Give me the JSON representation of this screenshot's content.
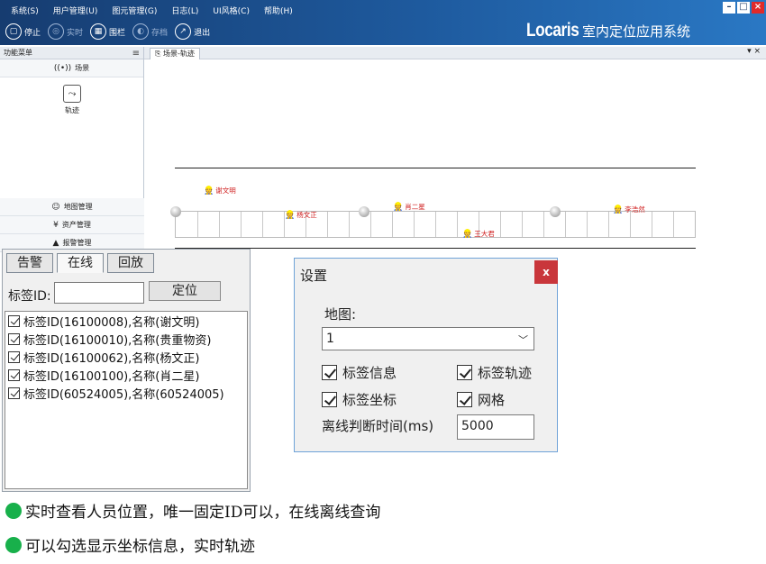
{
  "menubar": {
    "items": [
      "系统(S)",
      "用户管理(U)",
      "图元管理(G)",
      "日志(L)",
      "UI风格(C)",
      "帮助(H)"
    ]
  },
  "toolbar": {
    "stop": "停止",
    "realtime": "实时",
    "fence": "围栏",
    "store": "存档",
    "exit": "退出"
  },
  "brand": {
    "logo": "Locaris",
    "name": "室内定位应用系统"
  },
  "sidebar": {
    "header": "功能菜单",
    "scene": "场景",
    "track": "轨迹",
    "sections": [
      "地图管理",
      "资产管理",
      "报警管理"
    ]
  },
  "content_tab": "场景-轨迹",
  "map": {
    "people": [
      {
        "name": "谢文明"
      },
      {
        "name": "杨文正"
      },
      {
        "name": "肖二星"
      },
      {
        "name": "李浩然"
      },
      {
        "name": "王大君"
      }
    ]
  },
  "panel": {
    "tabs": [
      "告警",
      "在线",
      "回放"
    ],
    "active_tab": "在线",
    "tag_id_label": "标签ID:",
    "tag_id_value": "",
    "locate_button": "定位",
    "tags": [
      "标签ID(16100008),名称(谢文明)",
      "标签ID(16100010),名称(贵重物资)",
      "标签ID(16100062),名称(杨文正)",
      "标签ID(16100100),名称(肖二星)",
      "标签ID(60524005),名称(60524005)"
    ]
  },
  "dialog": {
    "title": "设置",
    "close": "x",
    "map_label": "地图:",
    "map_value": "1",
    "opt_tag_info": "标签信息",
    "opt_tag_track": "标签轨迹",
    "opt_tag_coord": "标签坐标",
    "opt_grid": "网格",
    "offline_label": "离线判断时间(ms)",
    "offline_value": "5000"
  },
  "notes": [
    "实时查看人员位置，唯一固定ID可以，在线离线查询",
    "可以勾选显示坐标信息，实时轨迹"
  ],
  "colors": {
    "title_bar": "#1e5a9e",
    "person_name": "#d02020",
    "dialog_close": "#c9363b",
    "note_dot": "#18b04b"
  }
}
